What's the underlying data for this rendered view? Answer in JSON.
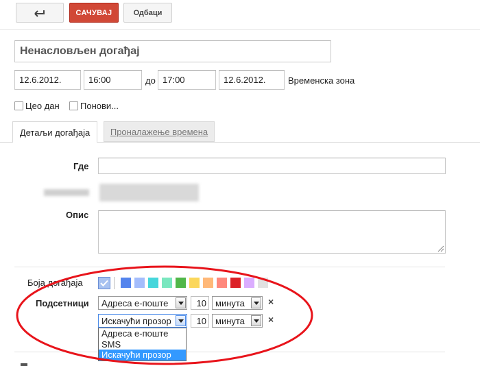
{
  "toolbar": {
    "back_icon": "arrow-left-icon",
    "save_label": "САЧУВАЈ",
    "cancel_label": "Одбаци"
  },
  "event": {
    "title": "Ненасловљен догађај",
    "start_date": "12.6.2012.",
    "start_time": "16:00",
    "to_label": "до",
    "end_time": "17:00",
    "end_date": "12.6.2012.",
    "timezone_link": "Временска зона",
    "all_day_label": "Цео дан",
    "repeat_label": "Понови..."
  },
  "tabs": [
    {
      "label": "Детаљи догађаја",
      "active": true
    },
    {
      "label": "Проналажење времена",
      "active": false
    }
  ],
  "details": {
    "where_label": "Где",
    "where_value": "",
    "description_label": "Опис",
    "description_value": ""
  },
  "color": {
    "label": "Боја догађаја",
    "swatches": [
      "#5484ed",
      "#a4bdfc",
      "#46d6db",
      "#7ae7bf",
      "#51b749",
      "#fbd75b",
      "#ffb878",
      "#ff887c",
      "#dc2127",
      "#dbadff",
      "#e1e1e1"
    ]
  },
  "reminders": {
    "label": "Подсетници",
    "rows": [
      {
        "method": "Адреса е-поште",
        "amount": "10",
        "unit": "минута",
        "remove": "×"
      },
      {
        "method": "Искачући прозор",
        "amount": "10",
        "unit": "минута",
        "remove": "×"
      }
    ],
    "dropdown_options": [
      "Адреса е-поште",
      "SMS",
      "Искачући прозор"
    ],
    "dropdown_selected": "Искачући прозор"
  },
  "annotation": {
    "color": "#e8141b",
    "shape": "ellipse"
  }
}
